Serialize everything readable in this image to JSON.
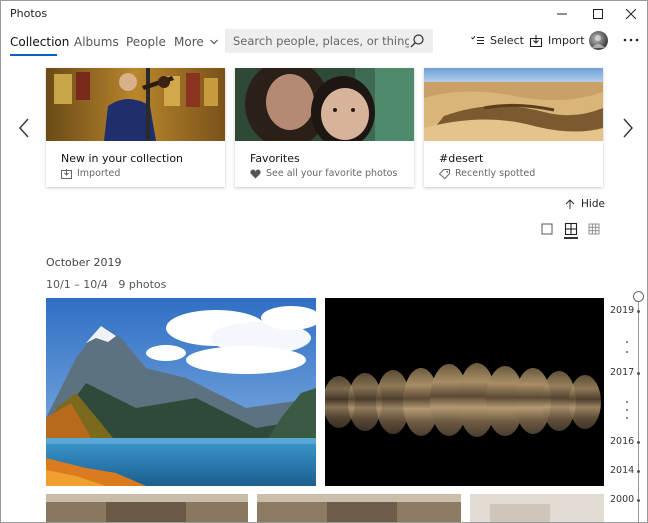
{
  "window": {
    "title": "Photos"
  },
  "nav": {
    "tabs": [
      {
        "label": "Collection",
        "active": true
      },
      {
        "label": "Albums"
      },
      {
        "label": "People"
      },
      {
        "label": "More"
      }
    ]
  },
  "search": {
    "placeholder": "Search people, places, or things..."
  },
  "actions": {
    "select_label": "Select",
    "import_label": "Import"
  },
  "carousel": {
    "cards": [
      {
        "title": "New in your collection",
        "subtitle": "Imported",
        "icon": "imported-icon"
      },
      {
        "title": "Favorites",
        "subtitle": "See all your favorite photos",
        "icon": "heart-icon"
      },
      {
        "title": "#desert",
        "subtitle": "Recently spotted",
        "icon": "tag-icon"
      }
    ]
  },
  "hide_label": "Hide",
  "section": {
    "month": "October 2019",
    "range": "10/1 – 10/4",
    "count": "9 photos"
  },
  "timeline": {
    "years": [
      "2019",
      "2017",
      "2016",
      "2014",
      "2000"
    ]
  },
  "colors": {
    "accent": "#0b5fbf",
    "title_text": "#222222"
  }
}
